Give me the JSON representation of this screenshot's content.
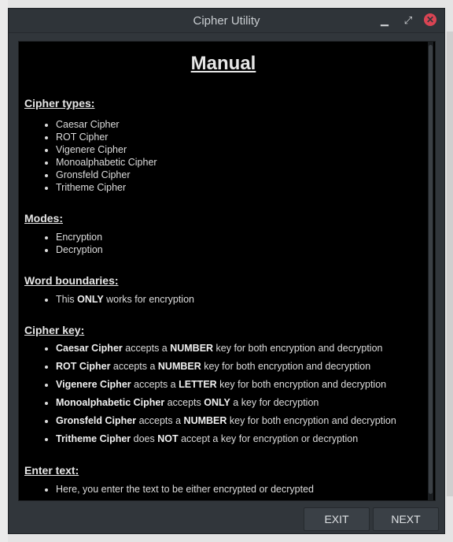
{
  "window": {
    "title": "Cipher Utility"
  },
  "manual": {
    "title": "Manual",
    "cipher_types": {
      "heading": "Cipher types:",
      "items": [
        "Caesar Cipher",
        "ROT Cipher",
        "Vigenere Cipher",
        "Monoalphabetic Cipher",
        "Gronsfeld Cipher",
        "Tritheme Cipher"
      ]
    },
    "modes": {
      "heading": "Modes:",
      "items": [
        "Encryption",
        "Decryption"
      ]
    },
    "word_boundaries": {
      "heading": "Word boundaries:",
      "item": {
        "pre": "This ",
        "bold": "ONLY",
        "post": " works for encryption"
      }
    },
    "cipher_key": {
      "heading": "Cipher key:",
      "items": [
        {
          "cipher": "Caesar Cipher",
          "mid": " accepts a ",
          "kw": "NUMBER",
          "rest": " key for both encryption and decryption"
        },
        {
          "cipher": "ROT Cipher",
          "mid": " accepts a ",
          "kw": "NUMBER",
          "rest": " key for both encryption and decryption"
        },
        {
          "cipher": "Vigenere Cipher",
          "mid": " accepts a ",
          "kw": "LETTER",
          "rest": " key for both encryption and decryption"
        },
        {
          "cipher": "Monoalphabetic Cipher",
          "mid": " accepts ",
          "kw": "ONLY",
          "rest": " a key for decryption"
        },
        {
          "cipher": "Gronsfeld Cipher",
          "mid": " accepts a ",
          "kw": "NUMBER",
          "rest": " key for both encryption and decryption"
        },
        {
          "cipher": "Tritheme Cipher",
          "mid": " does ",
          "kw": "NOT",
          "rest": " accept a key for encryption or decryption"
        }
      ]
    },
    "enter_text": {
      "heading": "Enter text:",
      "item": "Here, you enter the text to be either encrypted or decrypted"
    }
  },
  "buttons": {
    "exit": "EXIT",
    "next": "NEXT"
  },
  "titlebar_icons": {
    "minimize": "minimize-icon",
    "maximize": "maximize-icon",
    "close": "close-icon"
  },
  "colors": {
    "close": "#da4453",
    "window": "#31363b",
    "content": "#000000"
  }
}
